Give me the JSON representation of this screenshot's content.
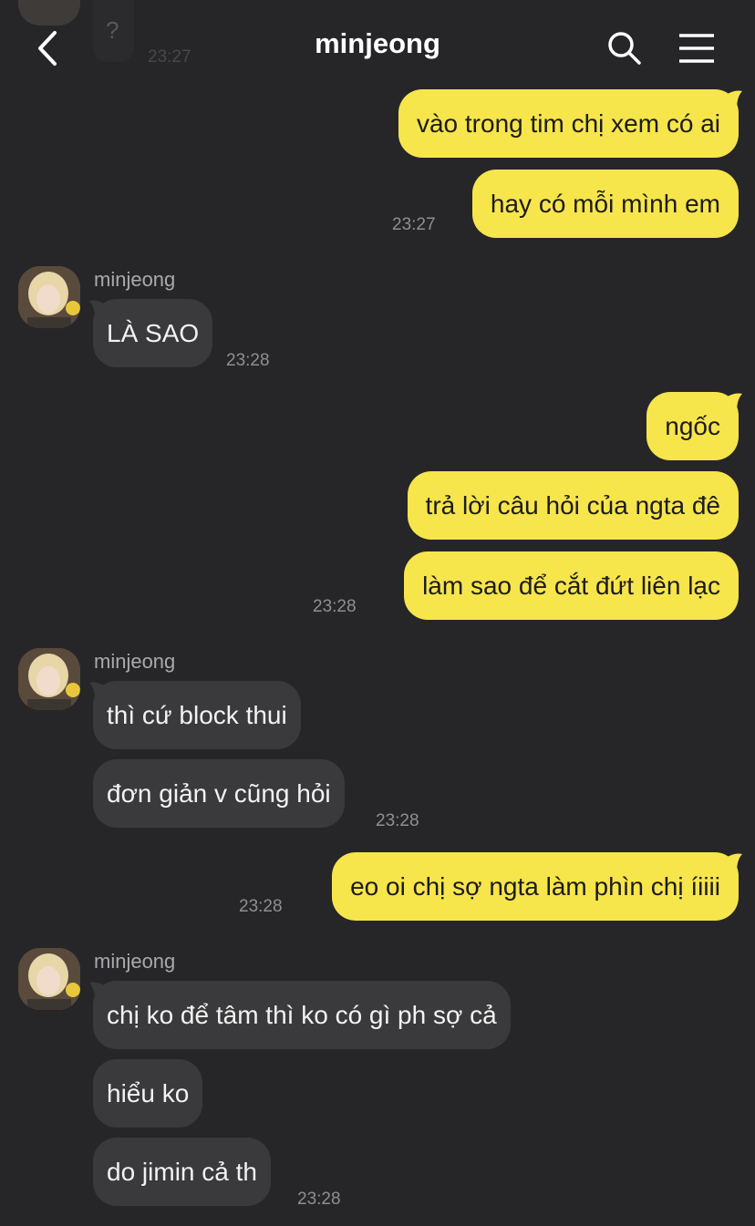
{
  "header": {
    "title": "minjeong"
  },
  "faded_top": {
    "text": "?",
    "time": "23:27"
  },
  "sender_name": "minjeong",
  "messages": {
    "m1": "vào trong tim chị xem có ai",
    "m2": "hay có mỗi mình em",
    "t1": "23:27",
    "m3": "LÀ SAO",
    "t2": "23:28",
    "m4": "ngốc",
    "m5": "trả lời câu hỏi của ngta đê",
    "m6": "làm sao để cắt đứt liên lạc",
    "t3": "23:28",
    "m7": "thì cứ block thui",
    "m8": "đơn giản v cũng hỏi",
    "t4": "23:28",
    "m9": "eo oi chị sợ ngta làm phìn chị íiiii",
    "t5": "23:28",
    "m10": "chị ko để tâm thì ko có gì ph sợ cả",
    "m11": "hiểu ko",
    "m12": "do jimin cả th",
    "t6": "23:28"
  },
  "icons": {
    "back": "chevron-left-icon",
    "search": "search-icon",
    "menu": "menu-icon"
  },
  "colors": {
    "background": "#262628",
    "outgoing": "#f7e54c",
    "incoming": "#3a3a3c"
  }
}
